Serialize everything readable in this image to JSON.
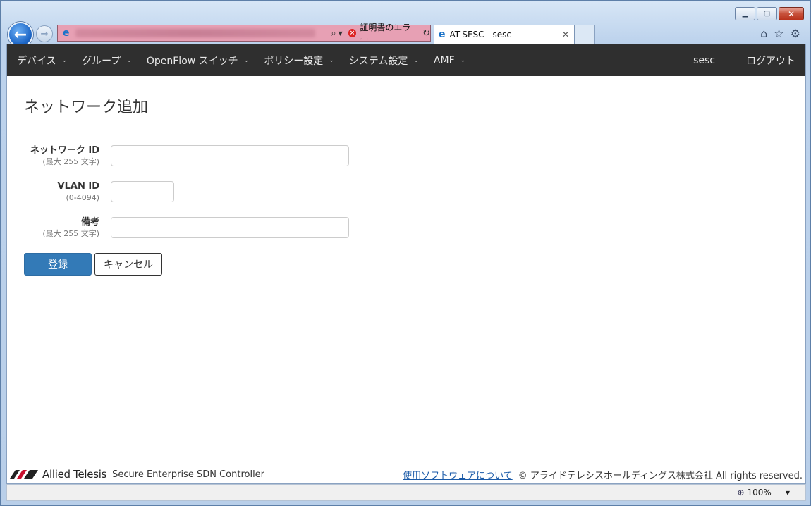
{
  "browser": {
    "address_error": "証明書のエラー",
    "tab_title": "AT-SESC - sesc"
  },
  "navbar": {
    "items": [
      {
        "label": "デバイス"
      },
      {
        "label": "グループ"
      },
      {
        "label": "OpenFlow スイッチ"
      },
      {
        "label": "ポリシー設定"
      },
      {
        "label": "システム設定"
      },
      {
        "label": "AMF"
      }
    ],
    "user": "sesc",
    "logout": "ログアウト"
  },
  "page": {
    "title": "ネットワーク追加"
  },
  "form": {
    "network_id": {
      "label": "ネットワーク ID",
      "hint": "(最大 255 文字)",
      "value": ""
    },
    "vlan_id": {
      "label": "VLAN ID",
      "hint": "(0-4094)",
      "value": ""
    },
    "remarks": {
      "label": "備考",
      "hint": "(最大 255 文字)",
      "value": ""
    },
    "submit_label": "登録",
    "cancel_label": "キャンセル"
  },
  "footer": {
    "brand": "Allied Telesis",
    "product": "Secure Enterprise SDN Controller",
    "software_link": "使用ソフトウェアについて",
    "copyright": "© アライドテレシスホールディングス株式会社 All rights reserved."
  },
  "statusbar": {
    "zoom": "100%"
  },
  "colors": {
    "navbar_bg": "#2f2f2f",
    "primary": "#337ab7",
    "link": "#1a5aa8",
    "address_error_bg": "#e7a0b4",
    "logo_red": "#c8102e"
  }
}
